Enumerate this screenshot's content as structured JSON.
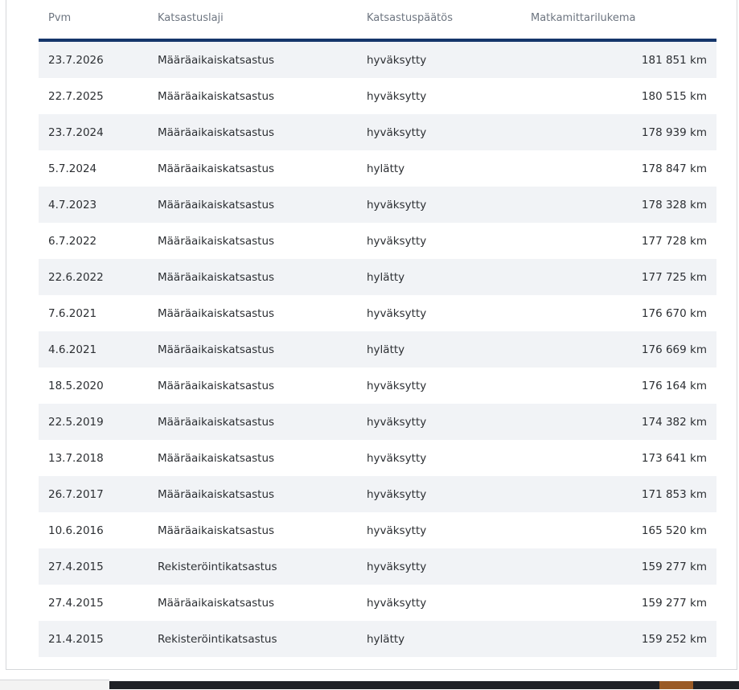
{
  "table": {
    "headers": {
      "date": "Pvm",
      "type": "Katsastuslaji",
      "result": "Katsastuspäätös",
      "odometer": "Matkamittarilukema"
    },
    "rows": [
      {
        "date": "23.7.2026",
        "type": "Määräaikaiskatsastus",
        "result": "hyväksytty",
        "odometer": "181 851 km"
      },
      {
        "date": "22.7.2025",
        "type": "Määräaikaiskatsastus",
        "result": "hyväksytty",
        "odometer": "180 515 km"
      },
      {
        "date": "23.7.2024",
        "type": "Määräaikaiskatsastus",
        "result": "hyväksytty",
        "odometer": "178 939 km"
      },
      {
        "date": "5.7.2024",
        "type": "Määräaikaiskatsastus",
        "result": "hylätty",
        "odometer": "178 847 km"
      },
      {
        "date": "4.7.2023",
        "type": "Määräaikaiskatsastus",
        "result": "hyväksytty",
        "odometer": "178 328 km"
      },
      {
        "date": "6.7.2022",
        "type": "Määräaikaiskatsastus",
        "result": "hyväksytty",
        "odometer": "177 728 km"
      },
      {
        "date": "22.6.2022",
        "type": "Määräaikaiskatsastus",
        "result": "hylätty",
        "odometer": "177 725 km"
      },
      {
        "date": "7.6.2021",
        "type": "Määräaikaiskatsastus",
        "result": "hyväksytty",
        "odometer": "176 670 km"
      },
      {
        "date": "4.6.2021",
        "type": "Määräaikaiskatsastus",
        "result": "hylätty",
        "odometer": "176 669 km"
      },
      {
        "date": "18.5.2020",
        "type": "Määräaikaiskatsastus",
        "result": "hyväksytty",
        "odometer": "176 164 km"
      },
      {
        "date": "22.5.2019",
        "type": "Määräaikaiskatsastus",
        "result": "hyväksytty",
        "odometer": "174 382 km"
      },
      {
        "date": "13.7.2018",
        "type": "Määräaikaiskatsastus",
        "result": "hyväksytty",
        "odometer": "173 641 km"
      },
      {
        "date": "26.7.2017",
        "type": "Määräaikaiskatsastus",
        "result": "hyväksytty",
        "odometer": "171 853 km"
      },
      {
        "date": "10.6.2016",
        "type": "Määräaikaiskatsastus",
        "result": "hyväksytty",
        "odometer": "165 520 km"
      },
      {
        "date": "27.4.2015",
        "type": "Rekisteröintikatsastus",
        "result": "hyväksytty",
        "odometer": "159 277 km"
      },
      {
        "date": "27.4.2015",
        "type": "Määräaikaiskatsastus",
        "result": "hyväksytty",
        "odometer": "159 277 km"
      },
      {
        "date": "21.4.2015",
        "type": "Rekisteröintikatsastus",
        "result": "hylätty",
        "odometer": "159 252 km"
      }
    ]
  },
  "colors": {
    "header_rule": "#15366b",
    "row_stripe": "#f1f3f6",
    "header_text": "#6d7580",
    "body_text": "#2c2f33"
  }
}
